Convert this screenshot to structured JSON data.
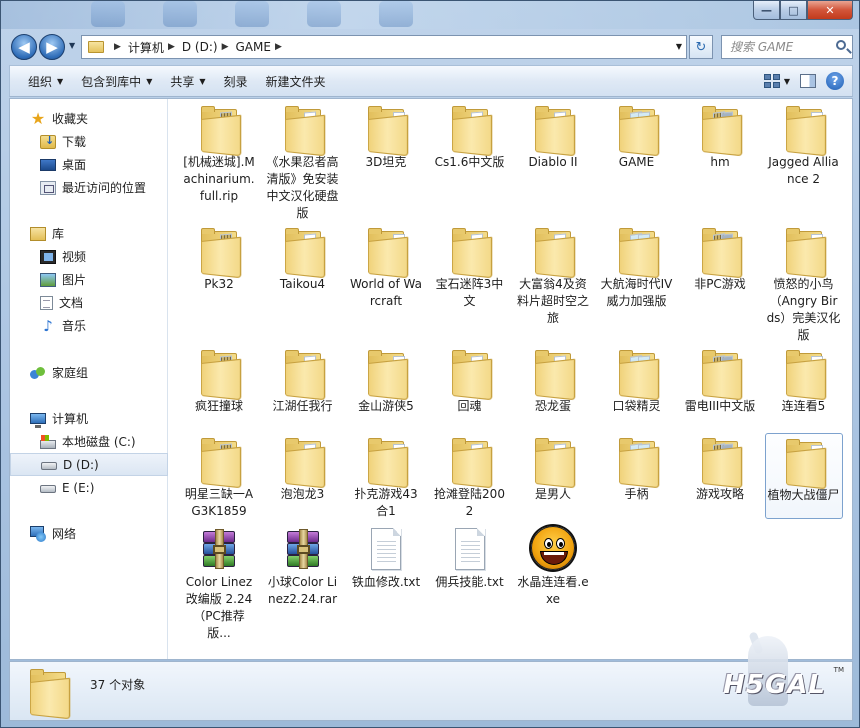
{
  "window": {
    "caption_min": "—",
    "caption_max": "□",
    "caption_close": "✕"
  },
  "nav": {
    "back_glyph": "◀",
    "forward_glyph": "▶",
    "breadcrumb": [
      "计算机",
      "D (D:)",
      "GAME"
    ],
    "refresh_glyph": "↻"
  },
  "search": {
    "placeholder": "搜索 GAME"
  },
  "commands": {
    "organize": "组织",
    "include_in_library": "包含到库中",
    "share": "共享",
    "burn": "刻录",
    "new_folder": "新建文件夹",
    "help": "?"
  },
  "sidebar": {
    "favorites": {
      "label": "收藏夹",
      "items": [
        "下载",
        "桌面",
        "最近访问的位置"
      ]
    },
    "libraries": {
      "label": "库",
      "items": [
        "视频",
        "图片",
        "文档",
        "音乐"
      ]
    },
    "homegroup": {
      "label": "家庭组"
    },
    "computer": {
      "label": "计算机",
      "items": [
        "本地磁盘 (C:)",
        "D (D:)",
        "E (E:)"
      ],
      "selected": "D (D:)"
    },
    "network": {
      "label": "网络"
    }
  },
  "files": [
    {
      "name": "[机械迷城].Machinarium.full.rip",
      "type": "folder"
    },
    {
      "name": "《水果忍者高清版》免安装中文汉化硬盘版",
      "type": "folder"
    },
    {
      "name": "3D坦克",
      "type": "folder"
    },
    {
      "name": "Cs1.6中文版",
      "type": "folder"
    },
    {
      "name": "Diablo II",
      "type": "folder"
    },
    {
      "name": "GAME",
      "type": "folder"
    },
    {
      "name": "hm",
      "type": "folder"
    },
    {
      "name": "Jagged Alliance 2",
      "type": "folder"
    },
    {
      "name": "Pk32",
      "type": "folder"
    },
    {
      "name": "Taikou4",
      "type": "folder"
    },
    {
      "name": "World of Warcraft",
      "type": "folder"
    },
    {
      "name": "宝石迷阵3中文",
      "type": "folder"
    },
    {
      "name": "大富翁4及资料片超时空之旅",
      "type": "folder"
    },
    {
      "name": "大航海时代IV威力加强版",
      "type": "folder"
    },
    {
      "name": "非PC游戏",
      "type": "folder"
    },
    {
      "name": "愤怒的小鸟（Angry Birds）完美汉化版",
      "type": "folder"
    },
    {
      "name": "疯狂撞球",
      "type": "folder"
    },
    {
      "name": "江湖任我行",
      "type": "folder"
    },
    {
      "name": "金山游侠5",
      "type": "folder"
    },
    {
      "name": "回魂",
      "type": "folder"
    },
    {
      "name": "恐龙蛋",
      "type": "folder"
    },
    {
      "name": "口袋精灵",
      "type": "folder"
    },
    {
      "name": "雷电III中文版",
      "type": "folder"
    },
    {
      "name": "连连看5",
      "type": "folder"
    },
    {
      "name": "明星三缺一AG3K1859",
      "type": "folder"
    },
    {
      "name": "泡泡龙3",
      "type": "folder"
    },
    {
      "name": "扑克游戏43合1",
      "type": "folder"
    },
    {
      "name": "抢滩登陆2002",
      "type": "folder"
    },
    {
      "name": "是男人",
      "type": "folder"
    },
    {
      "name": "手柄",
      "type": "folder"
    },
    {
      "name": "游戏攻略",
      "type": "folder"
    },
    {
      "name": "植物大战僵尸",
      "type": "folder",
      "selected": true
    },
    {
      "name": "Color Linez改编版 2.24（PC推荐版...",
      "type": "rar"
    },
    {
      "name": "小球Color Linez2.24.rar",
      "type": "rar"
    },
    {
      "name": "铁血修改.txt",
      "type": "txt"
    },
    {
      "name": "佣兵技能.txt",
      "type": "txt"
    },
    {
      "name": "水晶连连看.exe",
      "type": "exe"
    }
  ],
  "status": {
    "count": "37 个对象"
  },
  "watermark": {
    "text": "H5GAL",
    "tm": "TM"
  }
}
